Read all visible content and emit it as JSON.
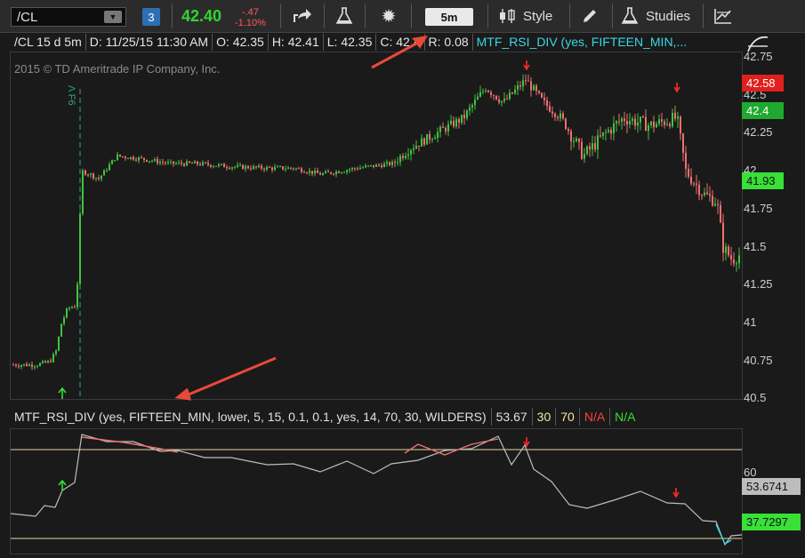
{
  "toolbar": {
    "symbol": "/CL",
    "link_badge": "3",
    "last_price": "42.40",
    "net_change": "-.47",
    "pct_change": "-1.10%",
    "aggregation": "5m",
    "style_label": "Style",
    "studies_label": "Studies"
  },
  "chart_header": {
    "title": "/CL 15 d 5m",
    "date": "D: 11/25/15 11:30 AM",
    "open": "O: 42.35",
    "high": "H: 42.41",
    "low": "L: 42.35",
    "close": "C: 42.4",
    "range": "R: 0.08",
    "study": "MTF_RSI_DIV (yes, FIFTEEN_MIN,..."
  },
  "copyright": "2015 © TD Ameritrade IP Company, Inc.",
  "f6_marker": "Λ F6",
  "price_axis": {
    "ticks": [
      "42.75",
      "42.5",
      "42.25",
      "42",
      "41.75",
      "41.5",
      "41.25",
      "41",
      "40.75",
      "40.5"
    ],
    "current_red": "42.58",
    "current_green": "42.4",
    "level_green": "41.93"
  },
  "lower_study": {
    "title": "MTF_RSI_DIV (yes, FIFTEEN_MIN, lower, 5, 15, 0.1, 0.1, yes, 14, 70, 30, WILDERS)",
    "value": "53.67",
    "ob": "30",
    "os": "70",
    "na_red": "N/A",
    "na_green": "N/A",
    "axis_tick": "60",
    "current_gray": "53.6741",
    "current_green": "37.7297"
  },
  "colors": {
    "up": "#3fc43f",
    "down": "#f07070",
    "line": "#bdbdbd",
    "level": "#e8d7a0",
    "arrow": "#ff2a2a",
    "annot": "#e84a3a"
  },
  "chart_data": {
    "type": "candlestick",
    "note_levels": [
      70,
      30
    ],
    "price_range": [
      40.5,
      42.8
    ]
  }
}
